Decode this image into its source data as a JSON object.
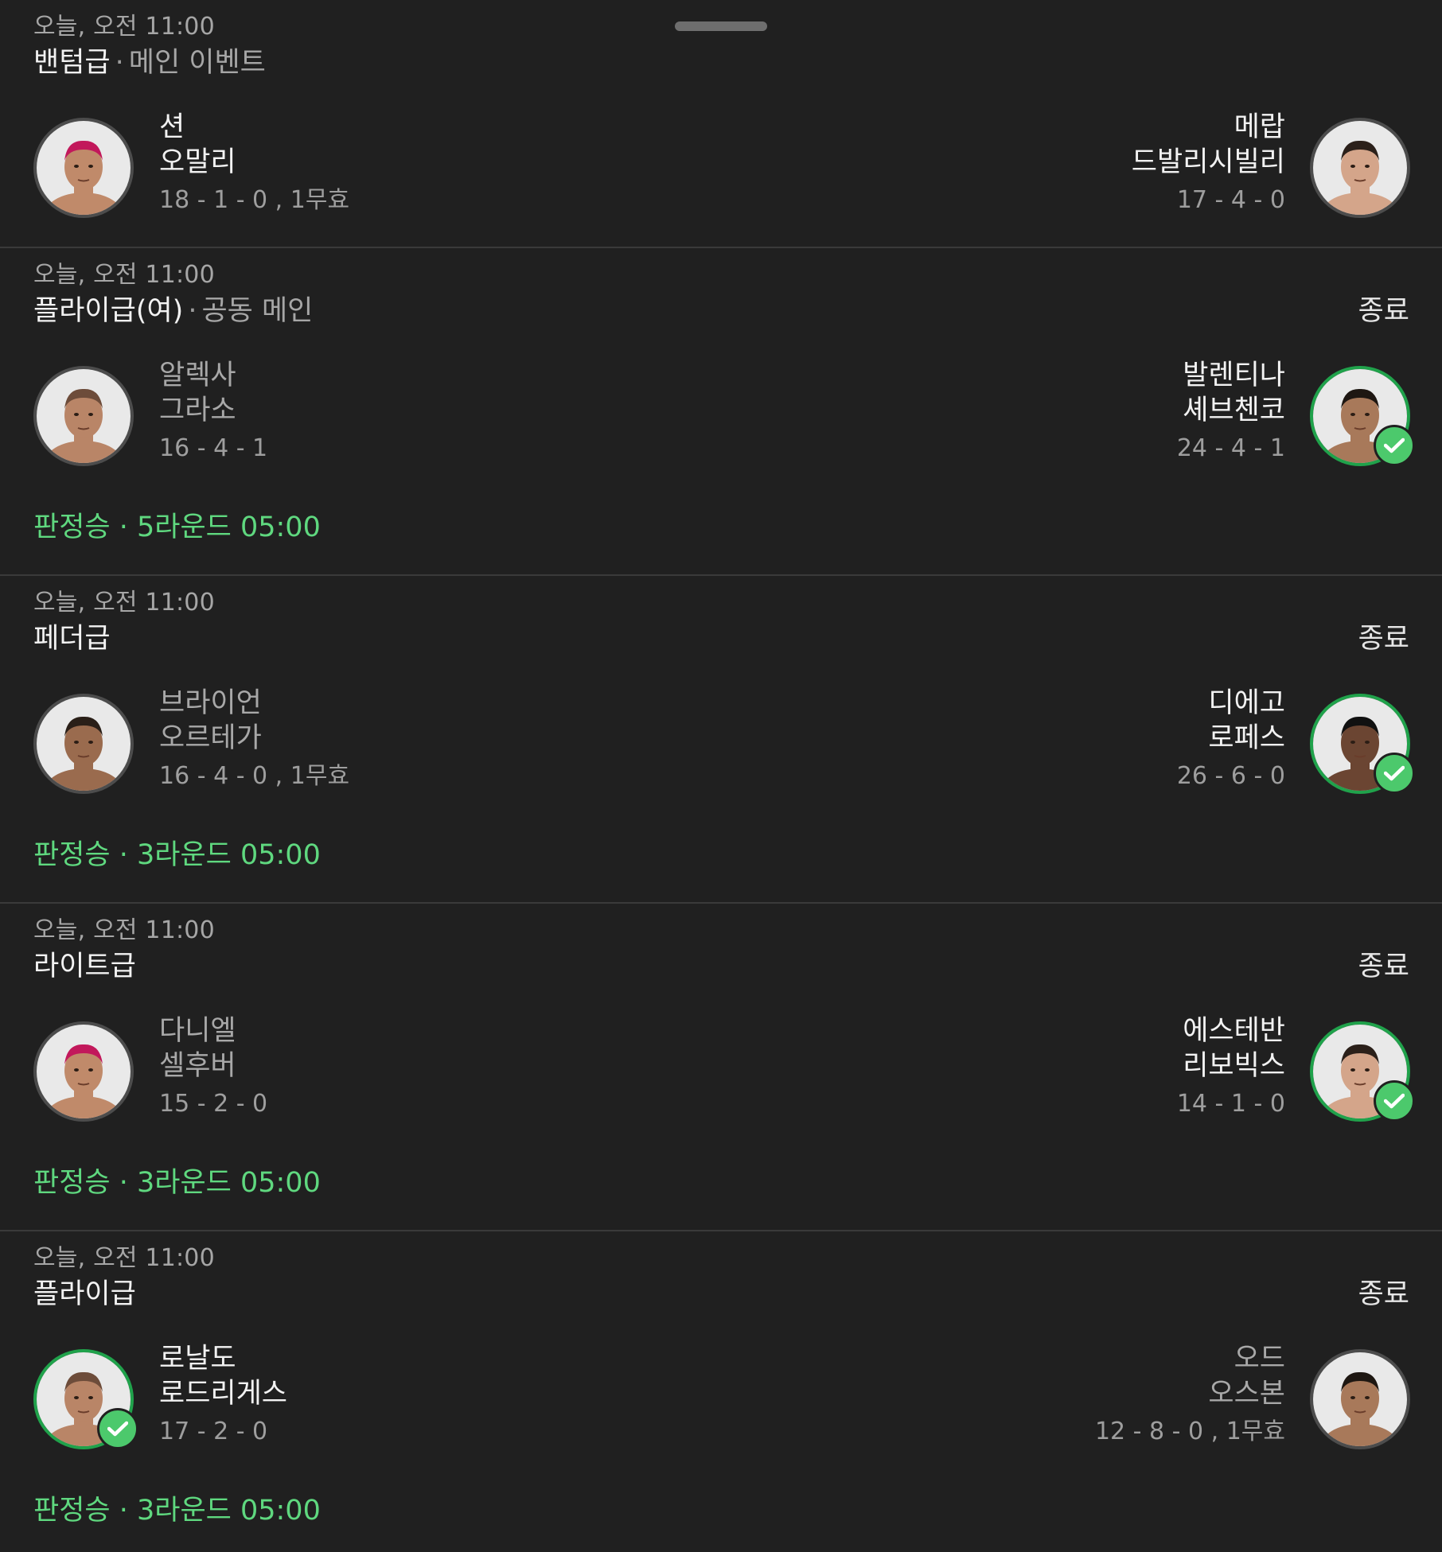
{
  "colors": {
    "background": "#202020",
    "winner_ring": "#20a24b",
    "check_badge": "#4cc96c",
    "result_text": "#5fd87f",
    "divider": "#3a3a3a"
  },
  "fights": [
    {
      "time": "오늘, 오전 11:00",
      "weight_class": "밴텀급",
      "bout_tag": "메인 이벤트",
      "status": "",
      "left": {
        "first": "션",
        "last": "오말리",
        "record": "18 - 1 - 0 , 1무효",
        "winner": false
      },
      "right": {
        "first": "메랍",
        "last": "드발리시빌리",
        "record": "17 - 4 - 0",
        "winner": false
      },
      "result": ""
    },
    {
      "time": "오늘, 오전 11:00",
      "weight_class": "플라이급(여)",
      "bout_tag": "공동 메인",
      "status": "종료",
      "left": {
        "first": "알렉사",
        "last": "그라소",
        "record": "16 - 4 - 1",
        "winner": false
      },
      "right": {
        "first": "발렌티나",
        "last": "셰브첸코",
        "record": "24 - 4 - 1",
        "winner": true
      },
      "result": "판정승 · 5라운드 05:00"
    },
    {
      "time": "오늘, 오전 11:00",
      "weight_class": "페더급",
      "bout_tag": "",
      "status": "종료",
      "left": {
        "first": "브라이언",
        "last": "오르테가",
        "record": "16 - 4 - 0 , 1무효",
        "winner": false
      },
      "right": {
        "first": "디에고",
        "last": "로페스",
        "record": "26 - 6 - 0",
        "winner": true
      },
      "result": "판정승 · 3라운드 05:00"
    },
    {
      "time": "오늘, 오전 11:00",
      "weight_class": "라이트급",
      "bout_tag": "",
      "status": "종료",
      "left": {
        "first": "다니엘",
        "last": "셀후버",
        "record": "15 - 2 - 0",
        "winner": false
      },
      "right": {
        "first": "에스테반",
        "last": "리보빅스",
        "record": "14 - 1 - 0",
        "winner": true
      },
      "result": "판정승 · 3라운드 05:00"
    },
    {
      "time": "오늘, 오전 11:00",
      "weight_class": "플라이급",
      "bout_tag": "",
      "status": "종료",
      "left": {
        "first": "로날도",
        "last": "로드리게스",
        "record": "17 - 2 - 0",
        "winner": true
      },
      "right": {
        "first": "오드",
        "last": "오스본",
        "record": "12 - 8 - 0 , 1무효",
        "winner": false
      },
      "result": "판정승 · 3라운드 05:00"
    }
  ]
}
